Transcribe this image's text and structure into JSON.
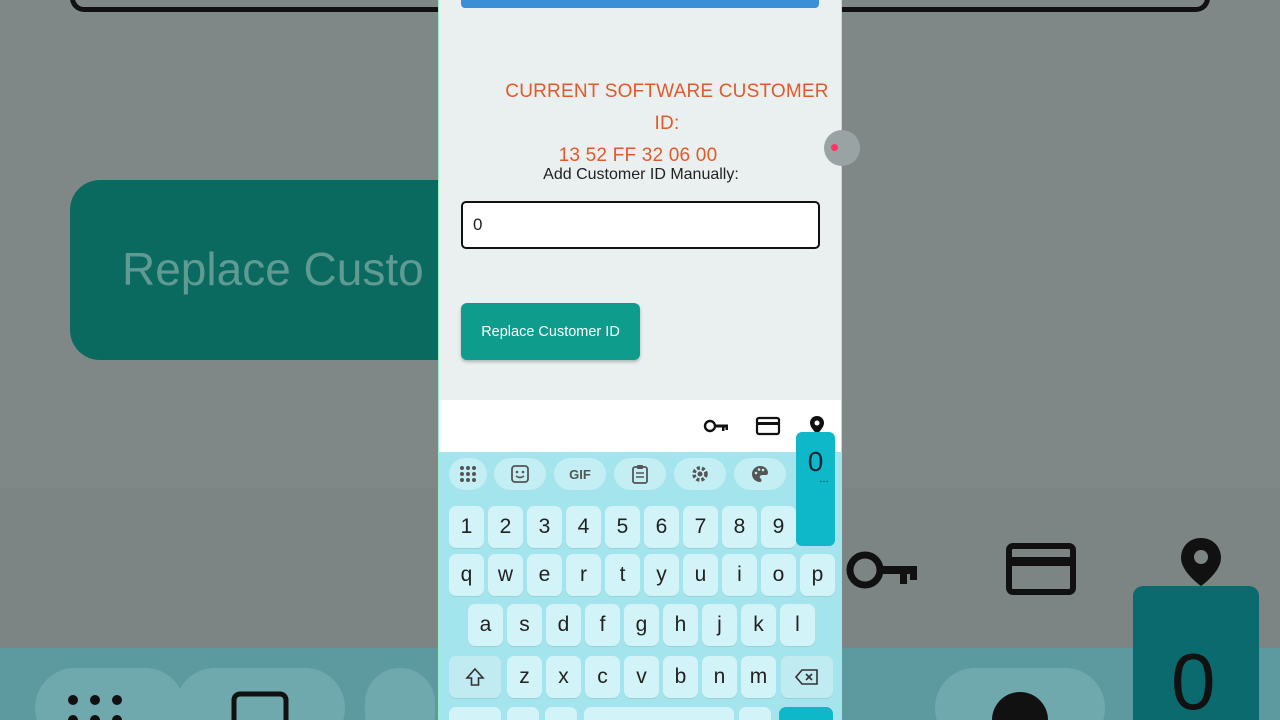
{
  "background": {
    "big_button_label": "Replace Custo",
    "zoom_popup_char": "0"
  },
  "app": {
    "current_id_line1": "CURRENT SOFTWARE CUSTOMER ID:",
    "current_id_line2": "13 52 FF 32 06 00",
    "add_label": "Add Customer ID Manually:",
    "input_value": "0",
    "replace_button": "Replace Customer ID"
  },
  "keyboard": {
    "tools": [
      "grid-icon",
      "sticker-icon",
      "GIF",
      "clipboard-icon",
      "settings-icon",
      "palette-icon"
    ],
    "gif_label": "GIF",
    "number_row": [
      "1",
      "2",
      "3",
      "4",
      "5",
      "6",
      "7",
      "8",
      "9"
    ],
    "row1": [
      "q",
      "w",
      "e",
      "r",
      "t",
      "y",
      "u",
      "i",
      "o",
      "p"
    ],
    "row2": [
      "a",
      "s",
      "d",
      "f",
      "g",
      "h",
      "j",
      "k",
      "l"
    ],
    "row3": [
      "z",
      "x",
      "c",
      "v",
      "b",
      "n",
      "m"
    ],
    "popup_char": "0",
    "popup_hint": "…"
  },
  "colors": {
    "accent_orange": "#e05a2a",
    "button_teal": "#0e9c8c",
    "keyboard_bg": "#a4e4ec",
    "popup_cyan": "#0fb8c9"
  }
}
